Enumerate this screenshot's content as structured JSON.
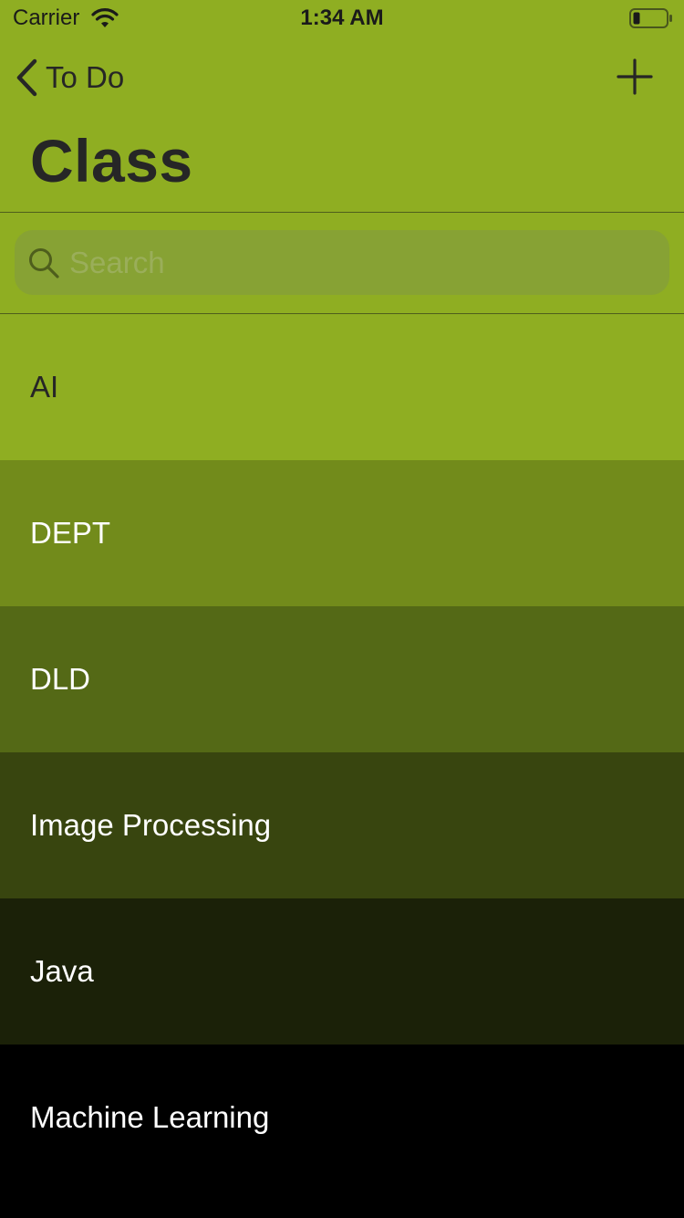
{
  "status_bar": {
    "carrier": "Carrier",
    "time": "1:34 AM",
    "wifi_icon": "wifi-icon",
    "battery_icon": "battery-low-icon"
  },
  "nav": {
    "back_label": "To Do",
    "back_icon": "chevron-left-icon",
    "add_icon": "plus-icon",
    "title": "Class"
  },
  "search": {
    "placeholder": "Search",
    "value": "",
    "icon": "search-icon"
  },
  "list": {
    "items": [
      {
        "label": "AI",
        "color": "#8fae22"
      },
      {
        "label": "DEPT",
        "color": "#728b1b"
      },
      {
        "label": "DLD",
        "color": "#546916"
      },
      {
        "label": "Image Processing",
        "color": "#38450f"
      },
      {
        "label": "Java",
        "color": "#1b2108"
      },
      {
        "label": "Machine Learning",
        "color": "#000000"
      }
    ]
  },
  "colors": {
    "accent": "#8fae22",
    "text_dark": "#262626",
    "text_light": "#ffffff"
  }
}
